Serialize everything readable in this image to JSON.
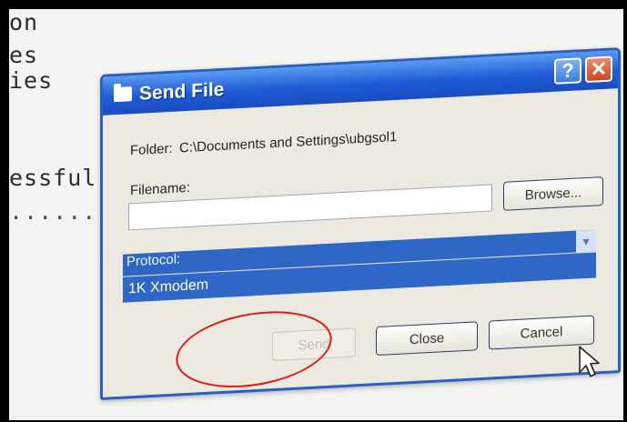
{
  "terminal": {
    "lines": [
      "on",
      "es",
      "ies",
      "essful",
      "......"
    ]
  },
  "dialog": {
    "title": "Send File",
    "help_glyph": "?",
    "close_glyph": "✕",
    "folder_label": "Folder:",
    "folder_path": "C:\\Documents and Settings\\ubgsol1",
    "filename_label": "Filename:",
    "filename_value": "",
    "browse_label": "Browse...",
    "protocol_label": "Protocol:",
    "protocol_selected": "1K Xmodem",
    "send_label": "Send",
    "close_label": "Close",
    "cancel_label": "Cancel"
  },
  "colors": {
    "titlebar": "#1d5ad6",
    "selection": "#2f67c9",
    "highlight_oval": "#e01818",
    "dialog_bg": "#eceae0"
  }
}
